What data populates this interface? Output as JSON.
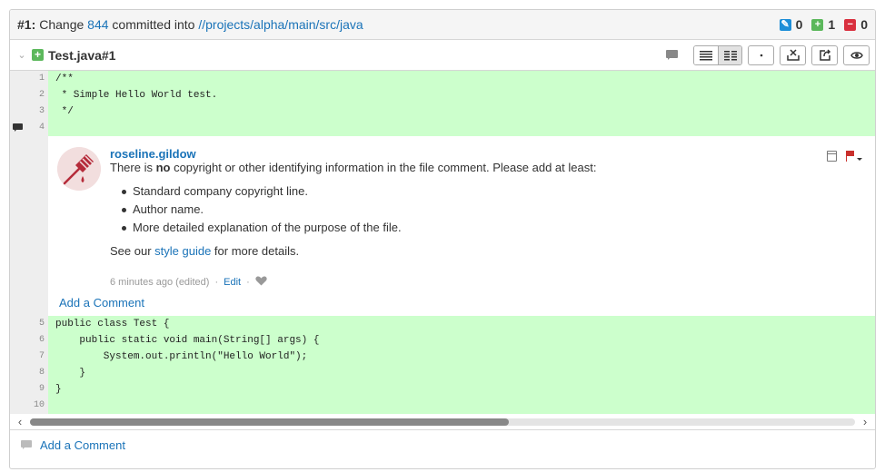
{
  "header": {
    "id": "#1:",
    "prefix": "Change",
    "change_number": "844",
    "middle": "committed into",
    "path": "//projects/alpha/main/src/java",
    "counts": {
      "edited": "0",
      "added": "1",
      "deleted": "0"
    }
  },
  "file": {
    "name": "Test.java#1",
    "tool_icons": [
      "comment-icon",
      "show-full-icon",
      "side-by-side-icon",
      "show-whitespace-icon",
      "download-icon",
      "open-icon",
      "view-icon"
    ]
  },
  "code_top": [
    {
      "line": "1",
      "text": "/**"
    },
    {
      "line": "2",
      "text": " * Simple Hello World test."
    },
    {
      "line": "3",
      "text": " */"
    },
    {
      "line": "4",
      "text": ""
    }
  ],
  "comment": {
    "author": "roseline.gildow",
    "text_before": "There is ",
    "text_bold": "no",
    "text_after": " copyright or other identifying information in the file comment. Please add at least:",
    "items": [
      "Standard company copyright line.",
      "Author name.",
      "More detailed explanation of the purpose of the file."
    ],
    "see_before": "See our ",
    "see_link": "style guide",
    "see_after": " for more details.",
    "time": "6 minutes ago (edited)",
    "sep1": "·",
    "edit": "Edit",
    "sep2": "·",
    "add_comment": "Add a Comment"
  },
  "code_bottom": [
    {
      "line": "5",
      "text": "public class Test {"
    },
    {
      "line": "6",
      "text": "    public static void main(String[] args) {"
    },
    {
      "line": "7",
      "text": "        System.out.println(\"Hello World\");"
    },
    {
      "line": "8",
      "text": "    }"
    },
    {
      "line": "9",
      "text": "}"
    },
    {
      "line": "10",
      "text": ""
    }
  ],
  "scroll": {
    "left_arrow": "‹",
    "right_arrow": "›",
    "position": 0.58
  },
  "footer": {
    "add_comment": "Add a Comment"
  },
  "colors": {
    "added_bg": "#ccffcc",
    "link": "#1a73b8",
    "edited": "#1d8ed8",
    "added": "#5cb85c",
    "deleted": "#d9303f"
  }
}
